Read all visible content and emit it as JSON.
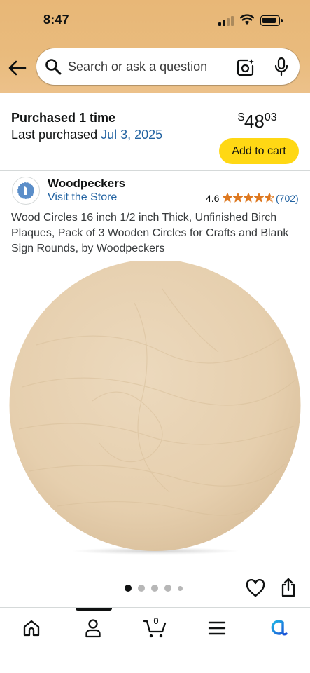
{
  "status_bar": {
    "time": "8:47"
  },
  "search": {
    "placeholder": "Search or ask a question"
  },
  "purchase": {
    "purchased_label": "Purchased 1 time",
    "last_purchased_label": "Last purchased",
    "last_purchased_date": "Jul 3, 2025",
    "price_currency": "$",
    "price_whole": "48",
    "price_fraction": "03",
    "add_to_cart": "Add to cart"
  },
  "store": {
    "name": "Woodpeckers",
    "visit_label": "Visit the Store",
    "rating": "4.6",
    "rating_count": "(702)",
    "stars_filled": 4.6
  },
  "product": {
    "title": "Wood Circles 16 inch 1/2 inch Thick, Unfinished Birch Plaques, Pack of 3 Wooden Circles for Crafts and Blank Sign Rounds, by Woodpeckers",
    "image_count": 5,
    "active_image": 0
  },
  "bottom_nav": {
    "items": [
      {
        "name": "home",
        "icon": "home-icon"
      },
      {
        "name": "account",
        "icon": "person-icon"
      },
      {
        "name": "cart",
        "icon": "cart-icon"
      },
      {
        "name": "menu",
        "icon": "menu-icon"
      },
      {
        "name": "rufus",
        "icon": "rufus-icon"
      }
    ],
    "cart_count": "0",
    "active": "account"
  },
  "colors": {
    "header": "#e8b777",
    "link": "#2162a1",
    "add_to_cart": "#ffd814",
    "star": "#de7921",
    "wood": "#e8d3b6"
  }
}
